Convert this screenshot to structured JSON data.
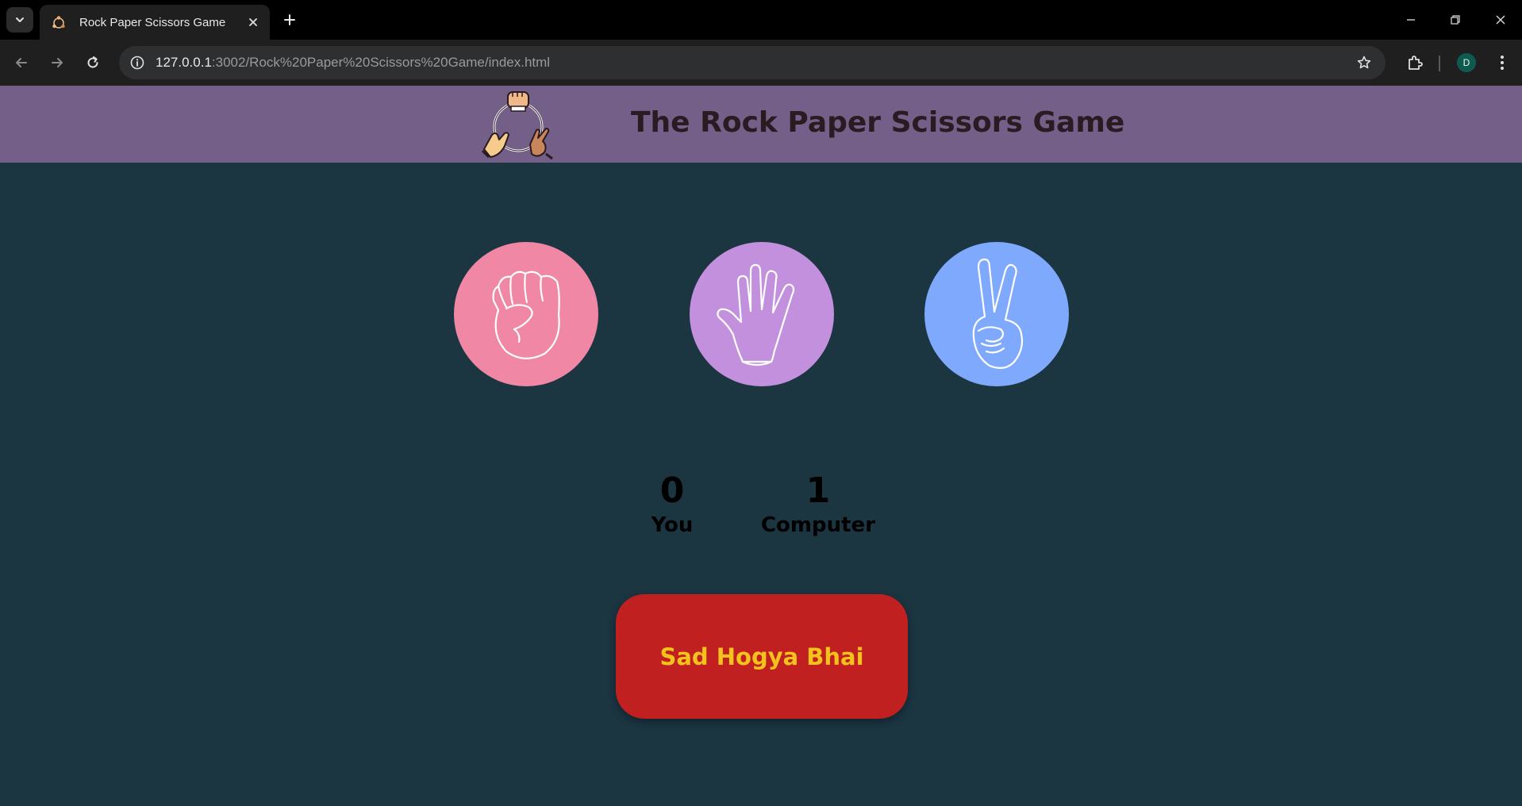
{
  "browser": {
    "tab_title": "Rock Paper Scissors Game",
    "url_host": "127.0.0.1",
    "url_path": ":3002/Rock%20Paper%20Scissors%20Game/index.html",
    "profile_initial": "D"
  },
  "header": {
    "title": "The Rock Paper Scissors Game"
  },
  "choices": [
    {
      "id": "rock",
      "icon": "rock-fist-icon",
      "color": "#f087a5"
    },
    {
      "id": "paper",
      "icon": "paper-hand-icon",
      "color": "#c390de"
    },
    {
      "id": "scissors",
      "icon": "scissors-hand-icon",
      "color": "#7fa9fd"
    }
  ],
  "scoreboard": {
    "user_score": "0",
    "user_label": "You",
    "computer_score": "1",
    "computer_label": "Computer"
  },
  "message": {
    "text": "Sad Hogya Bhai",
    "background": "#c02020",
    "text_color": "#f3c21d"
  }
}
